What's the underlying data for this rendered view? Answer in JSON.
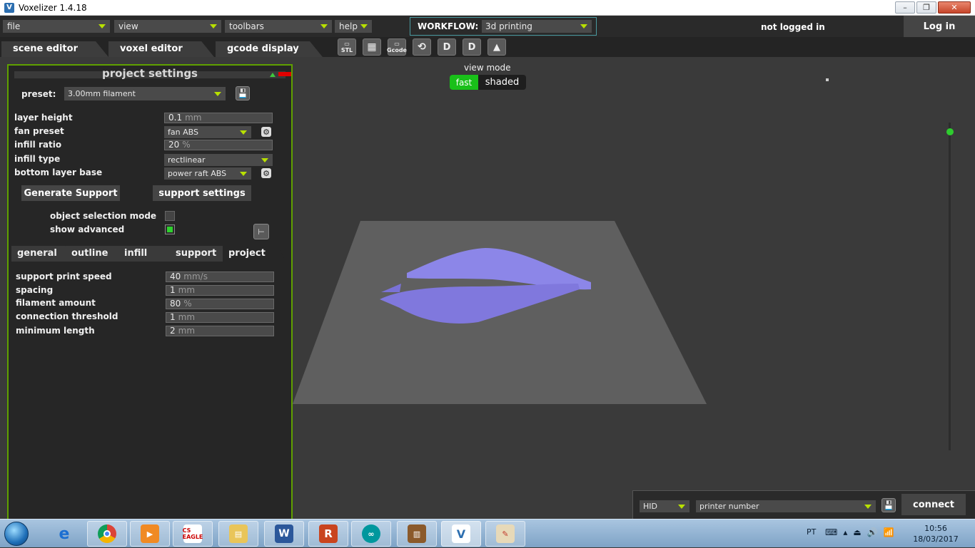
{
  "window": {
    "title": "Voxelizer 1.4.18",
    "app_icon": "V",
    "minimize": "–",
    "restore": "❐",
    "close": "✕"
  },
  "menubar": {
    "file": "file",
    "view": "view",
    "toolbars": "toolbars",
    "help": "help",
    "workflow_label": "WORKFLOW:",
    "workflow_value": "3d printing",
    "login_status": "not logged in",
    "login_button": "Log in"
  },
  "tabs": {
    "scene_editor": "scene editor",
    "voxel_editor": "voxel editor",
    "gcode_display": "gcode display"
  },
  "toolbar": {
    "icons": [
      "open-stl-icon",
      "checker-icon",
      "open-gcode-icon",
      "rotate-icon",
      "voxel-d-icon",
      "voxel-d2-icon",
      "mountain-icon"
    ],
    "stl_label": "STL",
    "gcode_label": "Gcode"
  },
  "panel": {
    "title": "project settings",
    "preset_label": "preset:",
    "preset_value": "3.00mm filament",
    "layer_height_label": "layer height",
    "layer_height_value": "0.1",
    "layer_height_unit": "mm",
    "fan_preset_label": "fan preset",
    "fan_preset_value": "fan ABS",
    "infill_ratio_label": "infill ratio",
    "infill_ratio_value": "20",
    "infill_ratio_unit": "%",
    "infill_type_label": "infill type",
    "infill_type_value": "rectlinear",
    "bottom_layer_label": "bottom layer base",
    "bottom_layer_value": "power raft ABS",
    "generate_support": "Generate Support",
    "support_settings": "support settings",
    "object_selection_label": "object selection mode",
    "show_advanced_label": "show advanced",
    "subtabs": [
      "general",
      "outline",
      "infill",
      "support",
      "project"
    ],
    "support_print_speed_label": "support print speed",
    "support_print_speed_value": "40",
    "support_print_speed_unit": "mm/s",
    "spacing_label": "spacing",
    "spacing_value": "1",
    "spacing_unit": "mm",
    "filament_amount_label": "filament amount",
    "filament_amount_value": "80",
    "filament_amount_unit": "%",
    "connection_threshold_label": "connection threshold",
    "connection_threshold_value": "1",
    "connection_threshold_unit": "mm",
    "minimum_length_label": "minimum length",
    "minimum_length_value": "2",
    "minimum_length_unit": "mm"
  },
  "viewport": {
    "view_mode_label": "view mode",
    "fast": "fast",
    "shaded": "shaded",
    "model_color": "#8c86e8",
    "bed_color": "#5f5f5f"
  },
  "connection": {
    "port_type": "HID",
    "printer_number": "printer number",
    "connect": "connect"
  },
  "taskbar": {
    "apps": [
      "ie",
      "chrome",
      "media-player",
      "eagle",
      "explorer",
      "word",
      "r",
      "arduino",
      "copper",
      "voxelizer",
      "paint"
    ],
    "eagle_label": "CS EAGLE",
    "language": "PT",
    "time": "10:56",
    "date": "18/03/2017"
  }
}
